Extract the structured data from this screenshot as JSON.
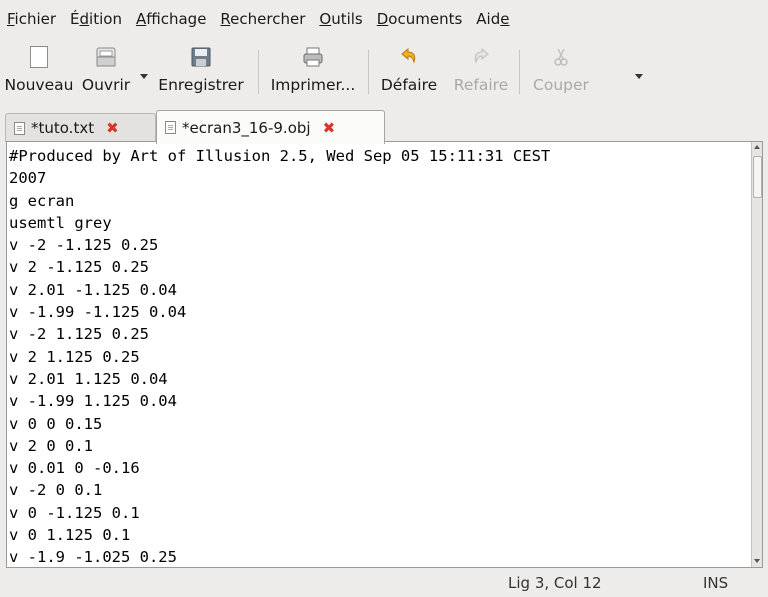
{
  "menu": [
    {
      "mnemonic": "F",
      "rest": "ichier"
    },
    {
      "pre": "É",
      "mnemonic": "d",
      "rest": "ition"
    },
    {
      "mnemonic": "A",
      "rest": "ffichage"
    },
    {
      "mnemonic": "R",
      "rest": "echercher"
    },
    {
      "mnemonic": "O",
      "rest": "utils"
    },
    {
      "mnemonic": "D",
      "rest": "ocuments"
    },
    {
      "pre": "Aid",
      "mnemonic": "e",
      "rest": ""
    }
  ],
  "toolbar": {
    "new_label": "Nouveau",
    "open_label": "Ouvrir",
    "save_label": "Enregistrer",
    "print_label": "Imprimer...",
    "undo_label": "Défaire",
    "redo_label": "Refaire",
    "cut_label": "Couper"
  },
  "tabs": [
    {
      "title": "*tuto.txt",
      "active": false
    },
    {
      "title": "*ecran3_16-9.obj",
      "active": true
    }
  ],
  "editor": {
    "lines": [
      "#Produced by Art of Illusion 2.5, Wed Sep 05 15:11:31 CEST",
      "2007",
      "g ecran",
      "usemtl grey",
      "v -2 -1.125 0.25",
      "v 2 -1.125 0.25",
      "v 2.01 -1.125 0.04",
      "v -1.99 -1.125 0.04",
      "v -2 1.125 0.25",
      "v 2 1.125 0.25",
      "v 2.01 1.125 0.04",
      "v -1.99 1.125 0.04",
      "v 0 0 0.15",
      "v 2 0 0.1",
      "v 0.01 0 -0.16",
      "v -2 0 0.1",
      "v 0 -1.125 0.1",
      "v 0 1.125 0.1",
      "v -1.9 -1.025 0.25"
    ]
  },
  "status": {
    "position": "Lig 3, Col 12",
    "mode": "INS"
  },
  "colors": {
    "window_bg": "#edeceb",
    "editor_bg": "#ffffff",
    "close_red": "#d9362b",
    "undo_arrow": "#e8a317",
    "disabled_text": "#a9a9a9"
  },
  "icons": {
    "new": "document-new-icon",
    "open": "folder-open-icon",
    "save": "floppy-disk-icon",
    "print": "printer-icon",
    "undo": "undo-arrow-icon",
    "redo": "redo-arrow-icon",
    "cut": "scissors-icon",
    "tab_doc": "text-document-icon",
    "tab_close": "close-x-icon"
  }
}
